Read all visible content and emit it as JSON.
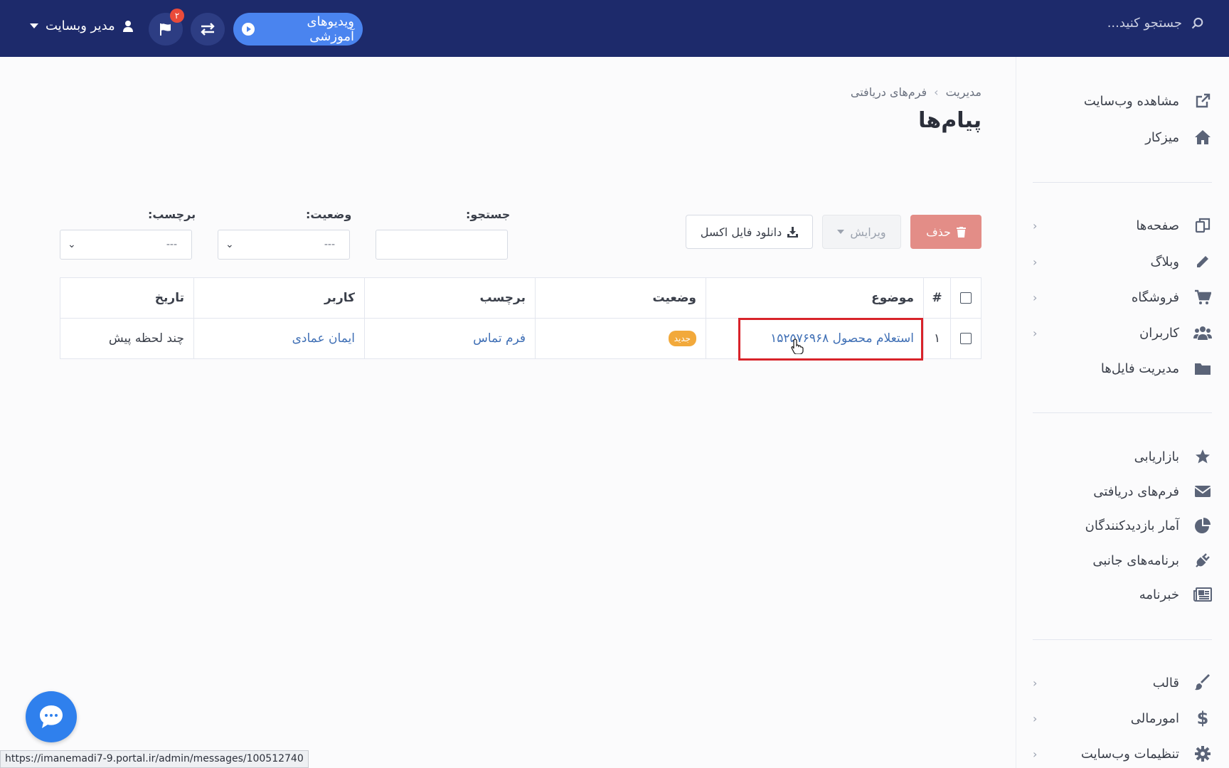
{
  "topbar": {
    "search_placeholder": "جستجو کنید...",
    "videos_label": "ویدیوهای آموزشی",
    "notifications_count": "۲",
    "user_label": "مدیر وبسایت"
  },
  "sidebar": {
    "group1": [
      {
        "label": "مشاهده وب‌سایت",
        "icon": "external-link-icon"
      },
      {
        "label": "میزکار",
        "icon": "home-icon"
      }
    ],
    "group2": [
      {
        "label": "صفحه‌ها",
        "icon": "pages-icon"
      },
      {
        "label": "وبلاگ",
        "icon": "pencil-icon"
      },
      {
        "label": "فروشگاه",
        "icon": "cart-icon"
      },
      {
        "label": "کاربران",
        "icon": "users-icon"
      },
      {
        "label": "مدیریت فایل‌ها",
        "icon": "folder-icon"
      }
    ],
    "group3": [
      {
        "label": "بازاریابی",
        "icon": "star-icon"
      },
      {
        "label": "فرم‌های دریافتی",
        "icon": "envelope-icon"
      },
      {
        "label": "آمار بازدیدکنندگان",
        "icon": "pie-chart-icon"
      },
      {
        "label": "برنامه‌های جانبی",
        "icon": "plug-icon"
      },
      {
        "label": "خبرنامه",
        "icon": "newspaper-icon"
      }
    ],
    "group4": [
      {
        "label": "قالب",
        "icon": "brush-icon"
      },
      {
        "label": "امورمالی",
        "icon": "dollar-icon"
      },
      {
        "label": "تنظیمات وب‌سایت",
        "icon": "gear-icon"
      }
    ]
  },
  "breadcrumb": [
    "مدیریت",
    "فرم‌های دریافتی"
  ],
  "page_title": "پیام‌ها",
  "toolbar": {
    "delete_label": "حذف",
    "edit_label": "ویرایش",
    "excel_label": "دانلود فایل اکسل"
  },
  "filters": {
    "search_label": "جستجو:",
    "status_label": "وضعیت:",
    "status_value": "---",
    "tag_label": "برچسب:",
    "tag_value": "---"
  },
  "table": {
    "columns": [
      "#",
      "موضوع",
      "وضعیت",
      "برچسب",
      "کاربر",
      "تاریخ"
    ],
    "rows": [
      {
        "num": "۱",
        "subject": "استعلام محصول ۱۵۲۵۷۶۹۶۸",
        "status": "جدید",
        "tag": "فرم تماس",
        "user": "ایمان عمادی",
        "date": "چند لحظه پیش"
      }
    ]
  },
  "statusbar_url": "https://imanemadi7-9.portal.ir/admin/messages/100512740"
}
